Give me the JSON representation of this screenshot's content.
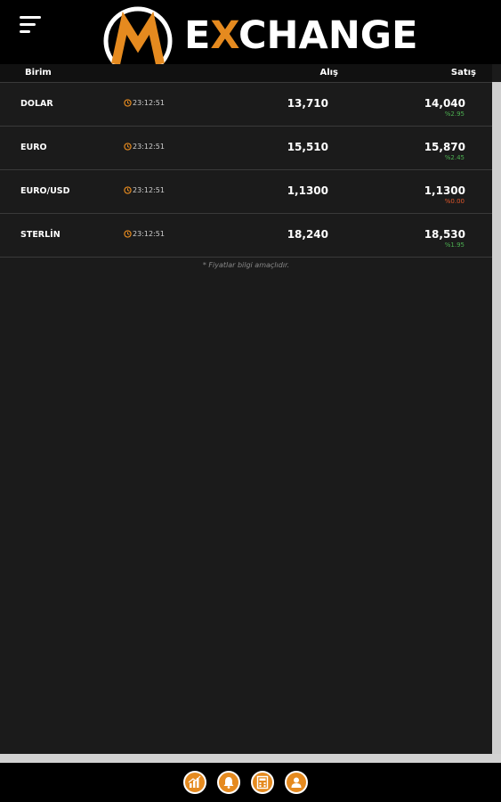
{
  "header": {
    "menu_icon": "hamburger-menu-icon",
    "logo_mark": "M",
    "logo_text_prefix": "E",
    "logo_text_accent": "X",
    "logo_text_rest": "CHANGE",
    "brand_color": "#e58a1f"
  },
  "columns": {
    "unit": "Birim",
    "buy": "Alış",
    "sell": "Satış"
  },
  "rates": [
    {
      "name": "DOLAR",
      "time": "23:12:51",
      "buy": "13,710",
      "sell": "14,040",
      "change": "%2.95",
      "direction": "up"
    },
    {
      "name": "EURO",
      "time": "23:12:51",
      "buy": "15,510",
      "sell": "15,870",
      "change": "%2.45",
      "direction": "up"
    },
    {
      "name": "EURO/USD",
      "time": "23:12:51",
      "buy": "1,1300",
      "sell": "1,1300",
      "change": "%0.00",
      "direction": "down"
    },
    {
      "name": "STERLİN",
      "time": "23:12:51",
      "buy": "18,240",
      "sell": "18,530",
      "change": "%1.95",
      "direction": "up"
    }
  ],
  "note": "* Fiyatlar bilgi amaçlıdır.",
  "colors": {
    "up": "#4caf50",
    "down": "#e0562a",
    "background": "#1b1b1b"
  },
  "bottom_nav": [
    {
      "icon": "chart-icon"
    },
    {
      "icon": "bell-icon"
    },
    {
      "icon": "calculator-icon"
    },
    {
      "icon": "user-icon"
    }
  ]
}
